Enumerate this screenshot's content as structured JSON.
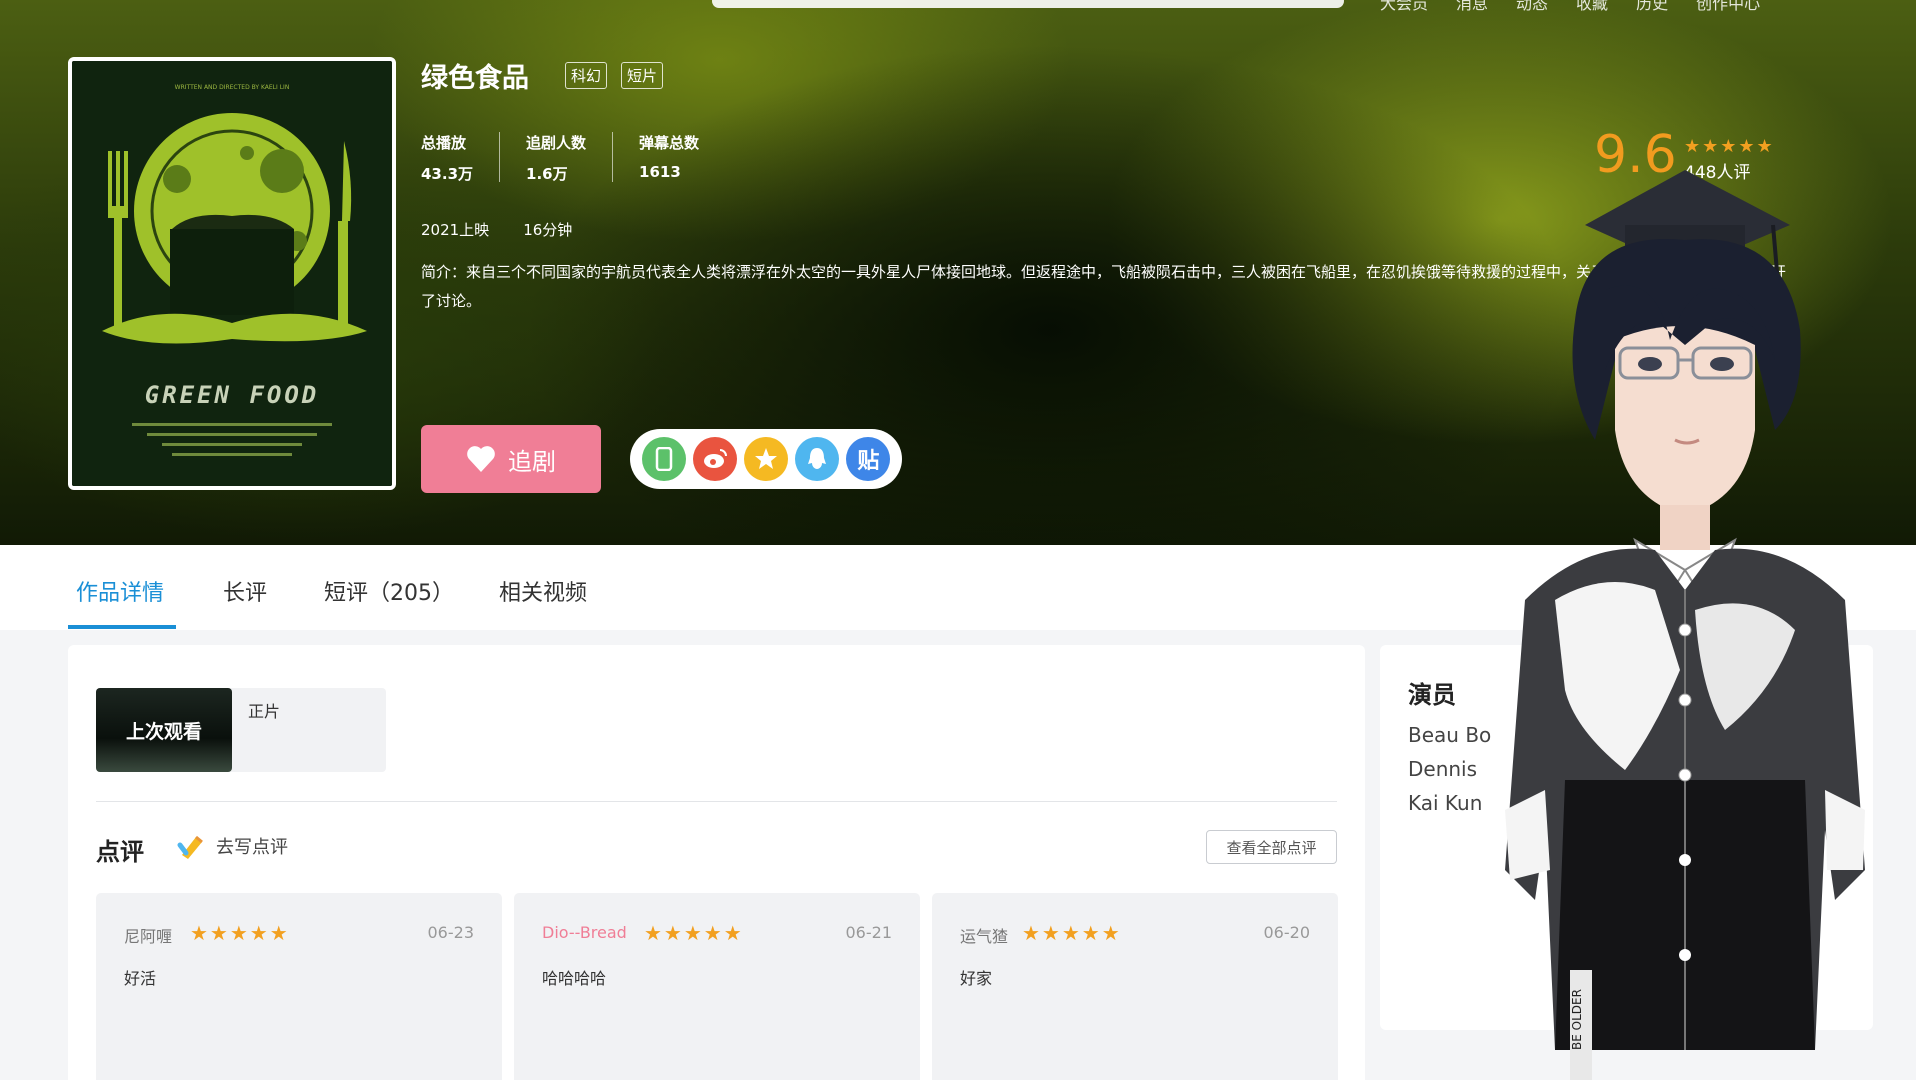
{
  "top_nav": {
    "items": [
      "大会员",
      "消息",
      "动态",
      "收藏",
      "历史",
      "创作中心"
    ]
  },
  "poster": {
    "caption_top": "WRITTEN AND DIRECTED BY KAELI LIN",
    "title": "GREEN FOOD"
  },
  "work": {
    "title": "绿色食品",
    "tags": [
      "科幻",
      "短片"
    ],
    "stats": [
      {
        "label": "总播放",
        "value": "43.3万"
      },
      {
        "label": "追剧人数",
        "value": "1.6万"
      },
      {
        "label": "弹幕总数",
        "value": "1613"
      }
    ],
    "release": "2021上映",
    "duration": "16分钟",
    "description": "简介：来自三个不同国家的宇航员代表全人类将漂浮在外太空的一具外星人尸体接回地球。但返程途中，飞船被陨石击中，三人被困在飞船里，在忍饥挨饿等待救援的过程中，关于要不要吃外星人的问题展开了讨论。",
    "follow_label": "追剧",
    "share_icons": [
      {
        "name": "phone-icon",
        "color": "#5cc16a",
        "glyph": "▯"
      },
      {
        "name": "weibo-icon",
        "color": "#e9543f",
        "glyph": "◉"
      },
      {
        "name": "qzone-icon",
        "color": "#f5b922",
        "glyph": "★"
      },
      {
        "name": "qq-icon",
        "color": "#4fb6ef",
        "glyph": "◕"
      },
      {
        "name": "tieba-icon",
        "color": "#3e86e8",
        "glyph": "贴"
      }
    ],
    "score": "9.6",
    "score_stars": "★★★★★",
    "score_count": "448人评"
  },
  "tabs": [
    "作品详情",
    "长评",
    "短评（205）",
    "相关视频"
  ],
  "active_tab": 0,
  "episode": {
    "thumb_label": "上次观看",
    "label": "正片"
  },
  "reviews": {
    "title": "点评",
    "write_label": "去写点评",
    "see_all_label": "查看全部点评",
    "items": [
      {
        "user": "尼阿喱",
        "user_color": "#777777",
        "stars": "★★★★★",
        "date": "06-23",
        "text": "好活"
      },
      {
        "user": "Dio--Bread",
        "user_color": "#f07e96",
        "stars": "★★★★★",
        "date": "06-21",
        "text": "哈哈哈哈"
      },
      {
        "user": "运气猹",
        "user_color": "#777777",
        "stars": "★★★★★",
        "date": "06-20",
        "text": "好家"
      }
    ]
  },
  "cast": {
    "title": "演员",
    "actors": [
      "Beau Bo",
      "Dennis",
      "Kai Kun"
    ]
  },
  "avatar_badge": "BE OLDER"
}
